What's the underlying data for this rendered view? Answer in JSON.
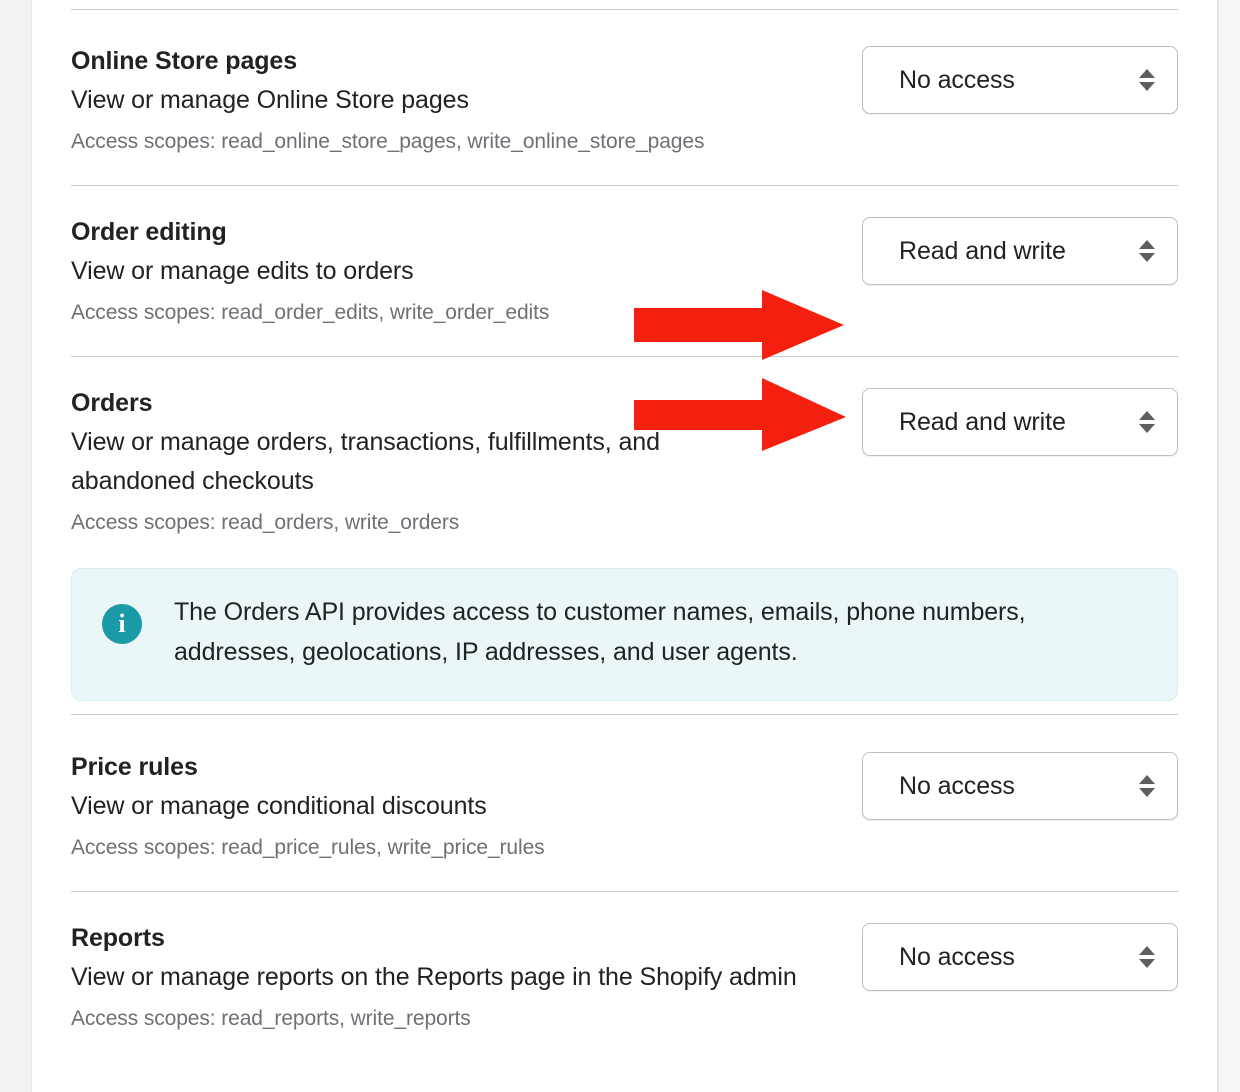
{
  "colors": {
    "accent_red": "#f4200f",
    "banner_bg": "#eaf6f7",
    "banner_icon": "#1a9aa6",
    "divider": "#c9cccf",
    "text": "#202223",
    "muted_text": "#6d7175"
  },
  "permissions": [
    {
      "title": "Online Store pages",
      "description": "View or manage Online Store pages",
      "scopes": "Access scopes: read_online_store_pages, write_online_store_pages",
      "access": "No access"
    },
    {
      "title": "Order editing",
      "description": "View or manage edits to orders",
      "scopes": "Access scopes: read_order_edits, write_order_edits",
      "access": "Read and write"
    },
    {
      "title": "Orders",
      "description": "View or manage orders, transactions, fulfillments, and abandoned checkouts",
      "scopes": "Access scopes: read_orders, write_orders",
      "access": "Read and write"
    },
    {
      "title": "Price rules",
      "description": "View or manage conditional discounts",
      "scopes": "Access scopes: read_price_rules, write_price_rules",
      "access": "No access"
    },
    {
      "title": "Reports",
      "description": "View or manage reports on the Reports page in the Shopify admin",
      "scopes": "Access scopes: read_reports, write_reports",
      "access": "No access"
    }
  ],
  "info_banner": {
    "icon": "info-icon",
    "text": "The Orders API provides access to customer names, emails, phone numbers, addresses, geolocations, IP addresses, and user agents."
  },
  "annotations": [
    {
      "name": "arrow-order-editing",
      "direction": "right"
    },
    {
      "name": "arrow-orders",
      "direction": "right"
    }
  ]
}
